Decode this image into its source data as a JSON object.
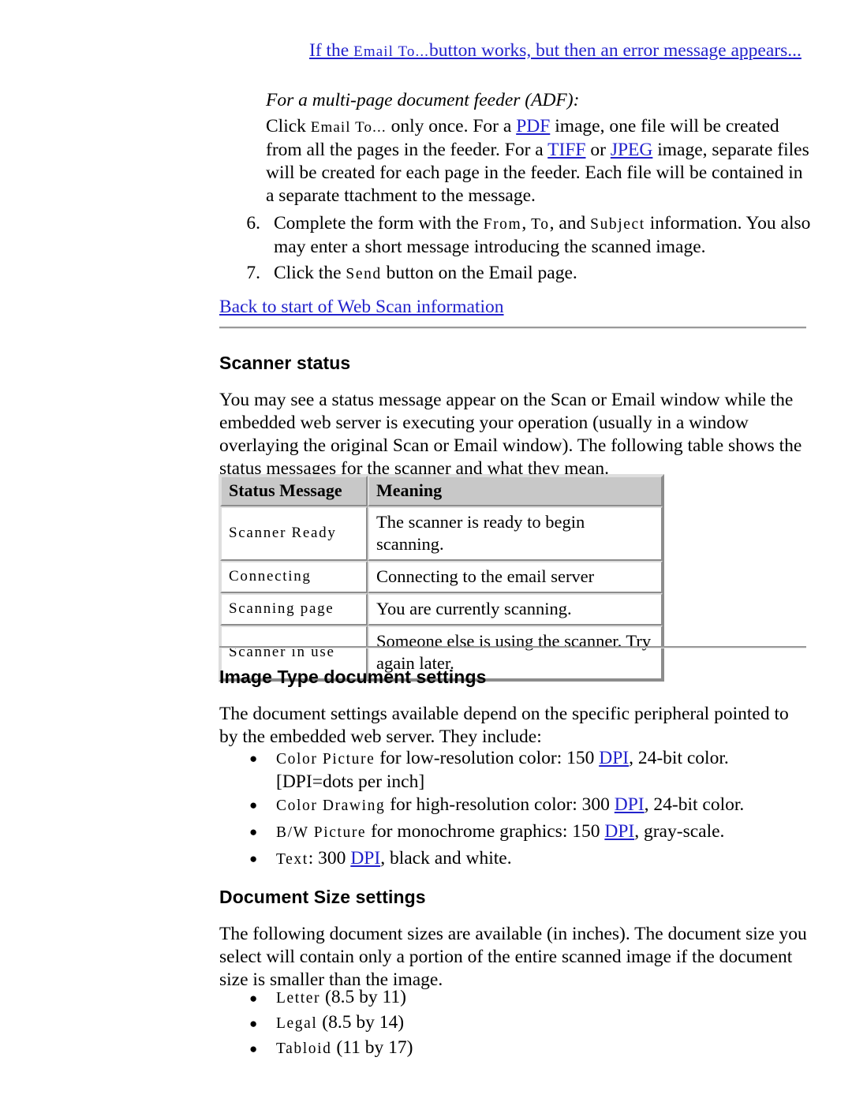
{
  "colors": {
    "link": "#2222cc",
    "text": "#000000",
    "table_header_bg": "#c8c8c8",
    "rule": "#9a9a9a",
    "page_bg": "#ffffff"
  },
  "top_link": {
    "prefix": "If the ",
    "ui_name": "Email To...",
    "suffix": "button works, but then an error message appears..."
  },
  "adf": {
    "heading": "For a multi-page document feeder (ADF):",
    "text_1": "Click ",
    "ui_name": "Email To...",
    "text_2": " only once. For a ",
    "link_pdf": "PDF",
    "text_3": " image, one file will be created from all the pages in the feeder. For a ",
    "link_tiff": "TIFF",
    "text_4": " or ",
    "link_jpeg": "JPEG",
    "text_5": " image, separate files will be created for each page in the feeder. Each file will be contained in a separate ttachment to the message."
  },
  "steps": [
    {
      "number": "6.",
      "text_1": "Complete the form with the ",
      "ui_1": "From",
      "text_2": ", ",
      "ui_2": "To",
      "text_3": ", and ",
      "ui_3": "Subject",
      "text_4": " information. You also may enter a short message introducing the scanned image."
    },
    {
      "number": "7.",
      "text_1": "Click the ",
      "ui_1": "Send",
      "text_2": " button on the Email page."
    }
  ],
  "back_link": "Back to start of Web Scan information",
  "scanner_status": {
    "heading": "Scanner status",
    "paragraph": "You may see a status message appear on the Scan or Email window while the embedded web server is executing your operation (usually in a window overlaying the original Scan or Email window). The following table shows the status messages for the scanner and what they mean.",
    "table": {
      "headers": [
        "Status Message",
        "Meaning"
      ],
      "rows": [
        [
          "Scanner Ready",
          "The scanner is ready to begin scanning."
        ],
        [
          "Connecting",
          "Connecting to the email server"
        ],
        [
          "Scanning page",
          "You are currently scanning."
        ],
        [
          "Scanner in use",
          "Someone else is using the scanner. Try again later."
        ]
      ]
    }
  },
  "image_type": {
    "heading": "Image Type document settings",
    "paragraph": "The document settings available depend on the specific peripheral pointed to by the embedded web server. They include:",
    "bullets": [
      {
        "ui": "Color Picture",
        "text_1": " for low-resolution color: 150 ",
        "link": "DPI",
        "text_2": ", 24-bit color.   [DPI=dots per inch]"
      },
      {
        "ui": "Color Drawing",
        "text_1": " for high-resolution color: 300 ",
        "link": "DPI",
        "text_2": ", 24-bit color."
      },
      {
        "ui": "B/W Picture",
        "text_1": " for monochrome graphics: 150 ",
        "link": "DPI",
        "text_2": ", gray-scale."
      },
      {
        "ui": "Text",
        "text_1": ": 300 ",
        "link": "DPI",
        "text_2": ", black and white."
      }
    ]
  },
  "document_size": {
    "heading": "Document Size settings",
    "paragraph": "The following document sizes are available (in inches). The document size you select will contain only a portion of the entire scanned image if the document size is smaller than the image.",
    "sizes": [
      {
        "name": "Letter",
        "dims": " (8.5 by 11)"
      },
      {
        "name": "Legal",
        "dims": " (8.5 by 14)"
      },
      {
        "name": "Tabloid",
        "dims": " (11 by 17)"
      }
    ]
  },
  "icons": {
    "bullet": "bullet-dot-icon"
  }
}
